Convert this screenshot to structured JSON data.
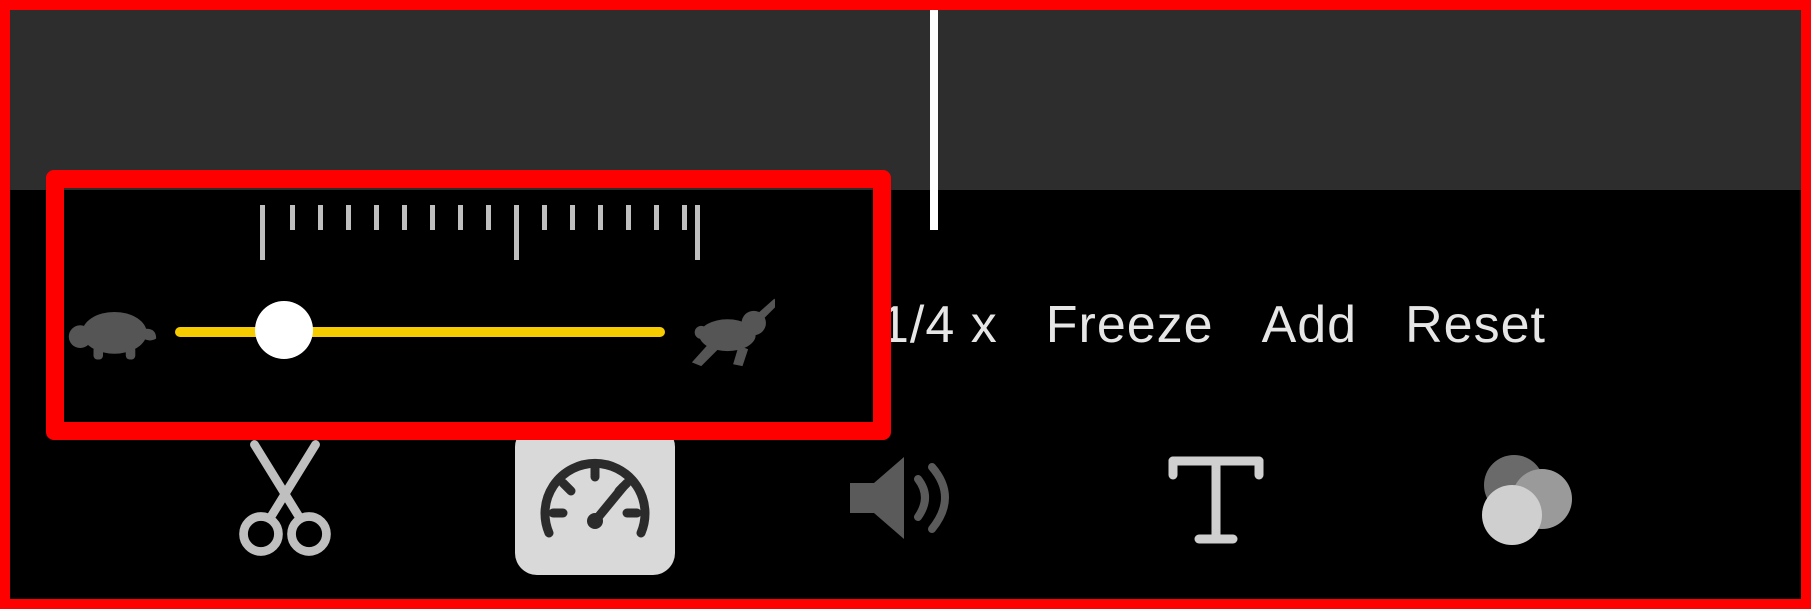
{
  "speed_controls": {
    "slow_icon": "turtle-icon",
    "fast_icon": "rabbit-icon",
    "slider_percent": 22,
    "track_color": "#f6cc00",
    "ruler_ticks": 17
  },
  "speed_buttons": {
    "rate_label": "1/4 x",
    "freeze_label": "Freeze",
    "add_label": "Add",
    "reset_label": "Reset"
  },
  "toolbar": {
    "cut_icon": "scissors-icon",
    "speed_icon": "speedometer-icon",
    "volume_icon": "speaker-icon",
    "text_icon": "text-icon",
    "filters_icon": "color-filters-icon",
    "selected": "speed"
  },
  "annotation": {
    "highlight": "speed-slider-area"
  }
}
